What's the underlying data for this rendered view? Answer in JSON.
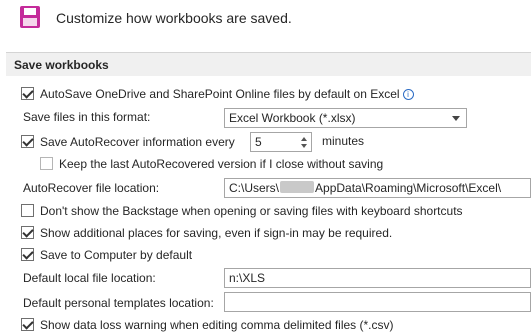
{
  "header": {
    "title": "Customize how workbooks are saved."
  },
  "section": {
    "title": "Save workbooks"
  },
  "autosave": {
    "checked": true,
    "label": "AutoSave OneDrive and SharePoint Online files by default on Excel"
  },
  "format": {
    "label": "Save files in this format:",
    "value": "Excel Workbook (*.xlsx)"
  },
  "autorecover": {
    "checked": true,
    "label": "Save AutoRecover information every",
    "minutes_value": "5",
    "unit_label": "minutes"
  },
  "keep_last": {
    "checked": false,
    "label": "Keep the last AutoRecovered version if I close without saving"
  },
  "autorecover_location": {
    "label": "AutoRecover file location:",
    "value_prefix": "C:\\Users\\",
    "value_suffix": "AppData\\Roaming\\Microsoft\\Excel\\"
  },
  "backstage": {
    "checked": false,
    "label": "Don't show the Backstage when opening or saving files with keyboard shortcuts"
  },
  "additional_places": {
    "checked": true,
    "label": "Show additional places for saving, even if sign-in may be required."
  },
  "save_to_computer": {
    "checked": true,
    "label": "Save to Computer by default"
  },
  "default_local": {
    "label": "Default local file location:",
    "value": "n:\\XLS"
  },
  "default_templates": {
    "label": "Default personal templates location:",
    "value": ""
  },
  "data_loss": {
    "checked": true,
    "label": "Show data loss warning when editing comma delimited files (*.csv)"
  },
  "colors": {
    "accent_icon": "#c42b9a",
    "section_bg": "#f0f0f0"
  },
  "icons": {
    "save": "floppy-save-icon",
    "info": "info-icon"
  }
}
